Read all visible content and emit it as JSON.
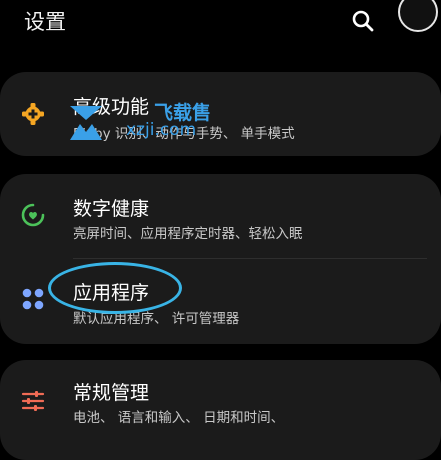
{
  "header": {
    "title": "设置",
    "search_icon": "search-icon",
    "avatar_icon": "avatar"
  },
  "rows": [
    {
      "key": "advanced",
      "icon": "puzzle-gear-icon",
      "icon_color": "#f5a623",
      "title": "高级功能",
      "subtitle": "Bixby 识别、动作与手势、 单手模式"
    },
    {
      "key": "digital_wellbeing",
      "icon": "wellbeing-icon",
      "icon_color": "#4cc25a",
      "title": "数字健康",
      "subtitle": "亮屏时间、应用程序定时器、轻松入眠"
    },
    {
      "key": "apps",
      "icon": "apps-grid-icon",
      "icon_color": "#7ea6ff",
      "title": "应用程序",
      "subtitle": "默认应用程序、 许可管理器"
    },
    {
      "key": "general_management",
      "icon": "sliders-icon",
      "icon_color": "#f06b55",
      "title": "常规管理",
      "subtitle": "电池、 语言和输入、 日期和时间、"
    }
  ],
  "watermark": {
    "line1": "飞载售",
    "line2": "xzji.com",
    "color": "#3aa0e8"
  },
  "highlight_color": "#39b4e6"
}
